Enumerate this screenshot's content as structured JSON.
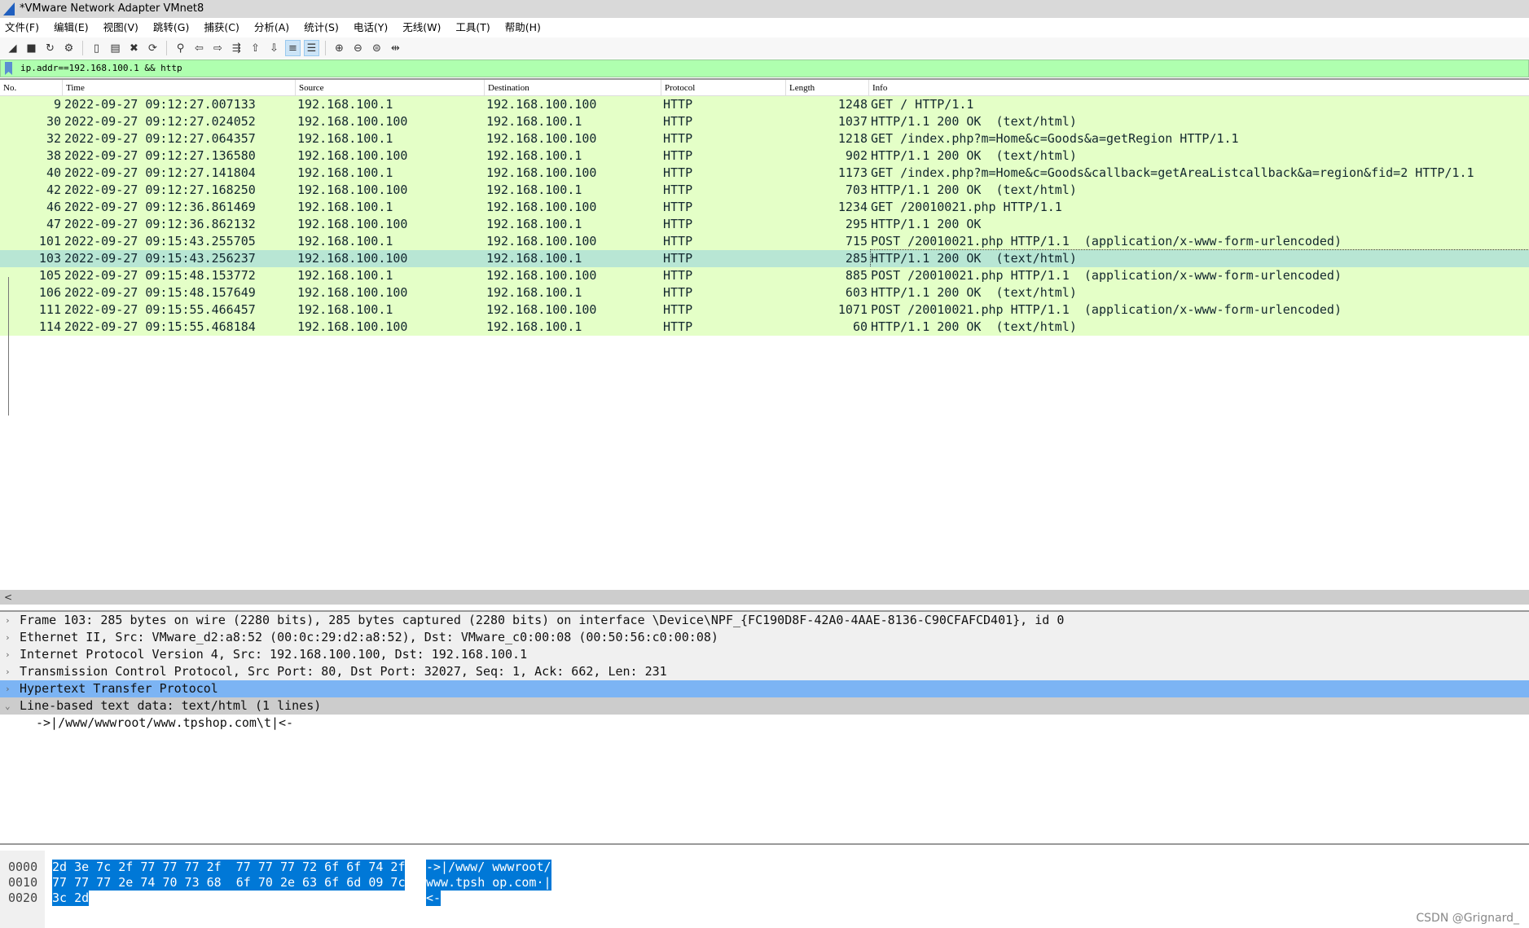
{
  "window": {
    "title": "*VMware Network Adapter VMnet8"
  },
  "menu": [
    "文件(F)",
    "编辑(E)",
    "视图(V)",
    "跳转(G)",
    "捕获(C)",
    "分析(A)",
    "统计(S)",
    "电话(Y)",
    "无线(W)",
    "工具(T)",
    "帮助(H)"
  ],
  "toolbar": [
    {
      "icon": "shark-fin-start-icon",
      "glyph": "◢"
    },
    {
      "icon": "stop-icon",
      "glyph": "■"
    },
    {
      "icon": "restart-icon",
      "glyph": "↻"
    },
    {
      "icon": "capture-options-icon",
      "glyph": "⚙"
    },
    {
      "icon": "open-file-icon",
      "glyph": "▯"
    },
    {
      "icon": "save-file-icon",
      "glyph": "▤"
    },
    {
      "icon": "close-file-icon",
      "glyph": "✖"
    },
    {
      "icon": "reload-icon",
      "glyph": "⟳"
    },
    {
      "icon": "find-packet-icon",
      "glyph": "⚲"
    },
    {
      "icon": "go-back-icon",
      "glyph": "⇦"
    },
    {
      "icon": "go-forward-icon",
      "glyph": "⇨"
    },
    {
      "icon": "go-to-packet-icon",
      "glyph": "⇶"
    },
    {
      "icon": "first-packet-icon",
      "glyph": "⇧"
    },
    {
      "icon": "last-packet-icon",
      "glyph": "⇩"
    },
    {
      "icon": "autoscroll-icon",
      "glyph": "≡",
      "active": true
    },
    {
      "icon": "colorize-icon",
      "glyph": "☰",
      "active": true
    },
    {
      "icon": "zoom-in-icon",
      "glyph": "⊕"
    },
    {
      "icon": "zoom-out-icon",
      "glyph": "⊖"
    },
    {
      "icon": "normal-size-icon",
      "glyph": "⊜"
    },
    {
      "icon": "resize-columns-icon",
      "glyph": "⇹"
    }
  ],
  "filter": {
    "value": "ip.addr==192.168.100.1 && http"
  },
  "columns": [
    "No.",
    "Time",
    "Source",
    "Destination",
    "Protocol",
    "Length",
    "Info"
  ],
  "packets": [
    {
      "no": "9",
      "time": "2022-09-27 09:12:27.007133",
      "src": "192.168.100.1",
      "dst": "192.168.100.100",
      "proto": "HTTP",
      "len": "1248",
      "info": "GET / HTTP/1.1"
    },
    {
      "no": "30",
      "time": "2022-09-27 09:12:27.024052",
      "src": "192.168.100.100",
      "dst": "192.168.100.1",
      "proto": "HTTP",
      "len": "1037",
      "info": "HTTP/1.1 200 OK  (text/html)"
    },
    {
      "no": "32",
      "time": "2022-09-27 09:12:27.064357",
      "src": "192.168.100.1",
      "dst": "192.168.100.100",
      "proto": "HTTP",
      "len": "1218",
      "info": "GET /index.php?m=Home&c=Goods&a=getRegion HTTP/1.1"
    },
    {
      "no": "38",
      "time": "2022-09-27 09:12:27.136580",
      "src": "192.168.100.100",
      "dst": "192.168.100.1",
      "proto": "HTTP",
      "len": "902",
      "info": "HTTP/1.1 200 OK  (text/html)"
    },
    {
      "no": "40",
      "time": "2022-09-27 09:12:27.141804",
      "src": "192.168.100.1",
      "dst": "192.168.100.100",
      "proto": "HTTP",
      "len": "1173",
      "info": "GET /index.php?m=Home&c=Goods&callback=getAreaListcallback&a=region&fid=2 HTTP/1.1"
    },
    {
      "no": "42",
      "time": "2022-09-27 09:12:27.168250",
      "src": "192.168.100.100",
      "dst": "192.168.100.1",
      "proto": "HTTP",
      "len": "703",
      "info": "HTTP/1.1 200 OK  (text/html)"
    },
    {
      "no": "46",
      "time": "2022-09-27 09:12:36.861469",
      "src": "192.168.100.1",
      "dst": "192.168.100.100",
      "proto": "HTTP",
      "len": "1234",
      "info": "GET /20010021.php HTTP/1.1"
    },
    {
      "no": "47",
      "time": "2022-09-27 09:12:36.862132",
      "src": "192.168.100.100",
      "dst": "192.168.100.1",
      "proto": "HTTP",
      "len": "295",
      "info": "HTTP/1.1 200 OK"
    },
    {
      "no": "101",
      "time": "2022-09-27 09:15:43.255705",
      "src": "192.168.100.1",
      "dst": "192.168.100.100",
      "proto": "HTTP",
      "len": "715",
      "info": "POST /20010021.php HTTP/1.1  (application/x-www-form-urlencoded)"
    },
    {
      "no": "103",
      "time": "2022-09-27 09:15:43.256237",
      "src": "192.168.100.100",
      "dst": "192.168.100.1",
      "proto": "HTTP",
      "len": "285",
      "info": "HTTP/1.1 200 OK  (text/html)",
      "selected": true
    },
    {
      "no": "105",
      "time": "2022-09-27 09:15:48.153772",
      "src": "192.168.100.1",
      "dst": "192.168.100.100",
      "proto": "HTTP",
      "len": "885",
      "info": "POST /20010021.php HTTP/1.1  (application/x-www-form-urlencoded)"
    },
    {
      "no": "106",
      "time": "2022-09-27 09:15:48.157649",
      "src": "192.168.100.100",
      "dst": "192.168.100.1",
      "proto": "HTTP",
      "len": "603",
      "info": "HTTP/1.1 200 OK  (text/html)"
    },
    {
      "no": "111",
      "time": "2022-09-27 09:15:55.466457",
      "src": "192.168.100.1",
      "dst": "192.168.100.100",
      "proto": "HTTP",
      "len": "1071",
      "info": "POST /20010021.php HTTP/1.1  (application/x-www-form-urlencoded)"
    },
    {
      "no": "114",
      "time": "2022-09-27 09:15:55.468184",
      "src": "192.168.100.100",
      "dst": "192.168.100.1",
      "proto": "HTTP",
      "len": "60",
      "info": "HTTP/1.1 200 OK  (text/html)"
    }
  ],
  "scroll_left": "<",
  "details": [
    {
      "text": "Frame 103: 285 bytes on wire (2280 bits), 285 bytes captured (2280 bits) on interface \\Device\\NPF_{FC190D8F-42A0-4AAE-8136-C90CFAFCD401}, id 0",
      "arrow": "›",
      "style": "g"
    },
    {
      "text": "Ethernet II, Src: VMware_d2:a8:52 (00:0c:29:d2:a8:52), Dst: VMware_c0:00:08 (00:50:56:c0:00:08)",
      "arrow": "›",
      "style": "g"
    },
    {
      "text": "Internet Protocol Version 4, Src: 192.168.100.100, Dst: 192.168.100.1",
      "arrow": "›",
      "style": "g"
    },
    {
      "text": "Transmission Control Protocol, Src Port: 80, Dst Port: 32027, Seq: 1, Ack: 662, Len: 231",
      "arrow": "›",
      "style": "g"
    },
    {
      "text": "Hypertext Transfer Protocol",
      "arrow": "›",
      "style": "hl"
    },
    {
      "text": "Line-based text data: text/html (1 lines)",
      "arrow": "⌄",
      "style": "g2"
    }
  ],
  "detail_sub": "->|/www/wwwroot/www.tpshop.com\\t|<-",
  "hex": [
    {
      "offset": "0000",
      "bytes": "2d 3e 7c 2f 77 77 77 2f  77 77 77 72 6f 6f 74 2f",
      "ascii": "->|/www/ wwwroot/"
    },
    {
      "offset": "0010",
      "bytes": "77 77 77 2e 74 70 73 68  6f 70 2e 63 6f 6d 09 7c",
      "ascii": "www.tpsh op.com·|"
    },
    {
      "offset": "0020",
      "bytes": "3c 2d",
      "ascii": "<-"
    }
  ],
  "watermark": "CSDN @Grignard_",
  "colors": {
    "row_bg": "#e4ffc7",
    "selected_row": "#b8e6d4",
    "filter_valid": "#afffaf",
    "detail_highlight": "#7cb4f4",
    "hex_selection": "#0078d7"
  }
}
